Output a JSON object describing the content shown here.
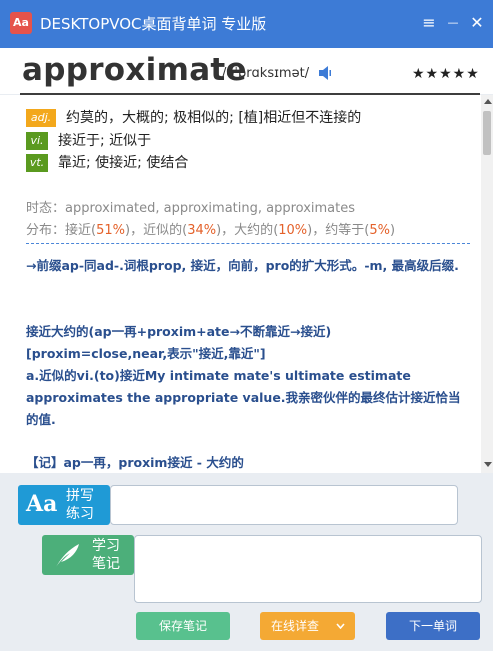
{
  "window": {
    "logo_text": "Aa",
    "title": "DESKTOPVOC桌面背单词 专业版",
    "menu_icon": "≡",
    "minimize_icon": "—",
    "close_icon": "✕"
  },
  "word": {
    "headword": "approximate",
    "phonetic": "/əˈprɑksɪmət/",
    "stars": "★★★★★",
    "rating": 5
  },
  "definitions": [
    {
      "pos": "adj.",
      "text": "约莫的，大概的; 极相似的; [植]相近但不连接的"
    },
    {
      "pos": "vi.",
      "text": "接近于; 近似于"
    },
    {
      "pos": "vt.",
      "text": "靠近; 使接近; 使结合"
    }
  ],
  "tense": {
    "label": "时态：",
    "forms": "approximated, approximating, approximates"
  },
  "distribution": {
    "label": "分布：",
    "items": [
      {
        "name": "接近",
        "pct": "51%"
      },
      {
        "name": "近似的",
        "pct": "34%"
      },
      {
        "name": "大约的",
        "pct": "10%"
      },
      {
        "name": "约等于",
        "pct": "5%"
      }
    ]
  },
  "notes": [
    "→前缀ap-同ad-.词根prop, 接近，向前，pro的扩大形式。-m, 最高级后缀.",
    "接近大约的(ap一再+proxim+ate→不断靠近→接近)",
    "[proxim=close,near,表示\"接近,靠近\"]",
    "a.近似的vi.(to)接近My intimate mate's ultimate estimate approximates the appropriate value.我亲密伙伴的最终估计接近恰当的值.",
    "【记】ap一再，proxim接近 - 大约的"
  ],
  "spell": {
    "icon_text": "Aa",
    "label_line1": "拼写",
    "label_line2": "练习",
    "value": ""
  },
  "study": {
    "label_line1": "学习",
    "label_line2": "笔记",
    "value": ""
  },
  "buttons": {
    "save": "保存笔记",
    "online": "在线详查",
    "next": "下一单词"
  },
  "colors": {
    "titlebar": "#3d7bd6",
    "spell_badge": "#1f9ad6",
    "study_badge": "#4caf7a",
    "save_button": "#58c18e",
    "online_button": "#f4a934",
    "next_button": "#3d6fc6",
    "highlight": "#e4612a"
  }
}
